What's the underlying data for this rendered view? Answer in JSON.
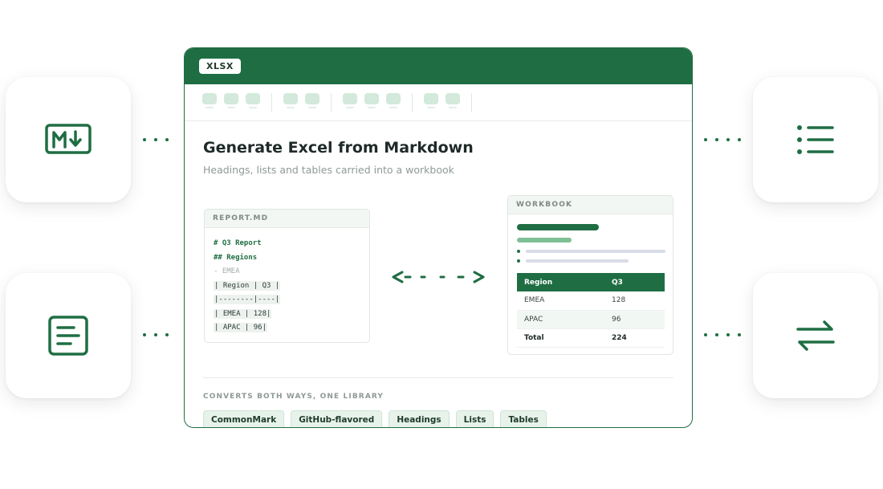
{
  "window": {
    "badge": "XLSX",
    "title": "Generate Excel from Markdown",
    "subtitle": "Headings, lists and tables carried into a workbook"
  },
  "markdown_panel": {
    "header": "REPORT.MD",
    "lines": [
      "# Q3 Report",
      "## Regions",
      "- EMEA",
      "| Region | Q3 |",
      "|--------|----|",
      "| EMEA | 128|",
      "| APAC | 96|"
    ]
  },
  "workbook_panel": {
    "header": "WORKBOOK",
    "table": {
      "headers": [
        "Region",
        "Q3"
      ],
      "rows": [
        [
          "EMEA",
          "128"
        ],
        [
          "APAC",
          "96"
        ],
        [
          "Total",
          "224"
        ]
      ]
    }
  },
  "footer": {
    "label": "CONVERTS BOTH WAYS, ONE LIBRARY",
    "chips": [
      "CommonMark",
      "GitHub-flavored",
      "Headings",
      "Lists",
      "Tables"
    ]
  },
  "icons": {
    "top_left": "markdown-icon",
    "bottom_left": "document-icon",
    "top_right": "list-icon",
    "bottom_right": "swap-icon"
  },
  "colors": {
    "accent": "#1f6e43",
    "accent_light": "#7fbf95",
    "chip_bg": "#e7f3ea"
  }
}
